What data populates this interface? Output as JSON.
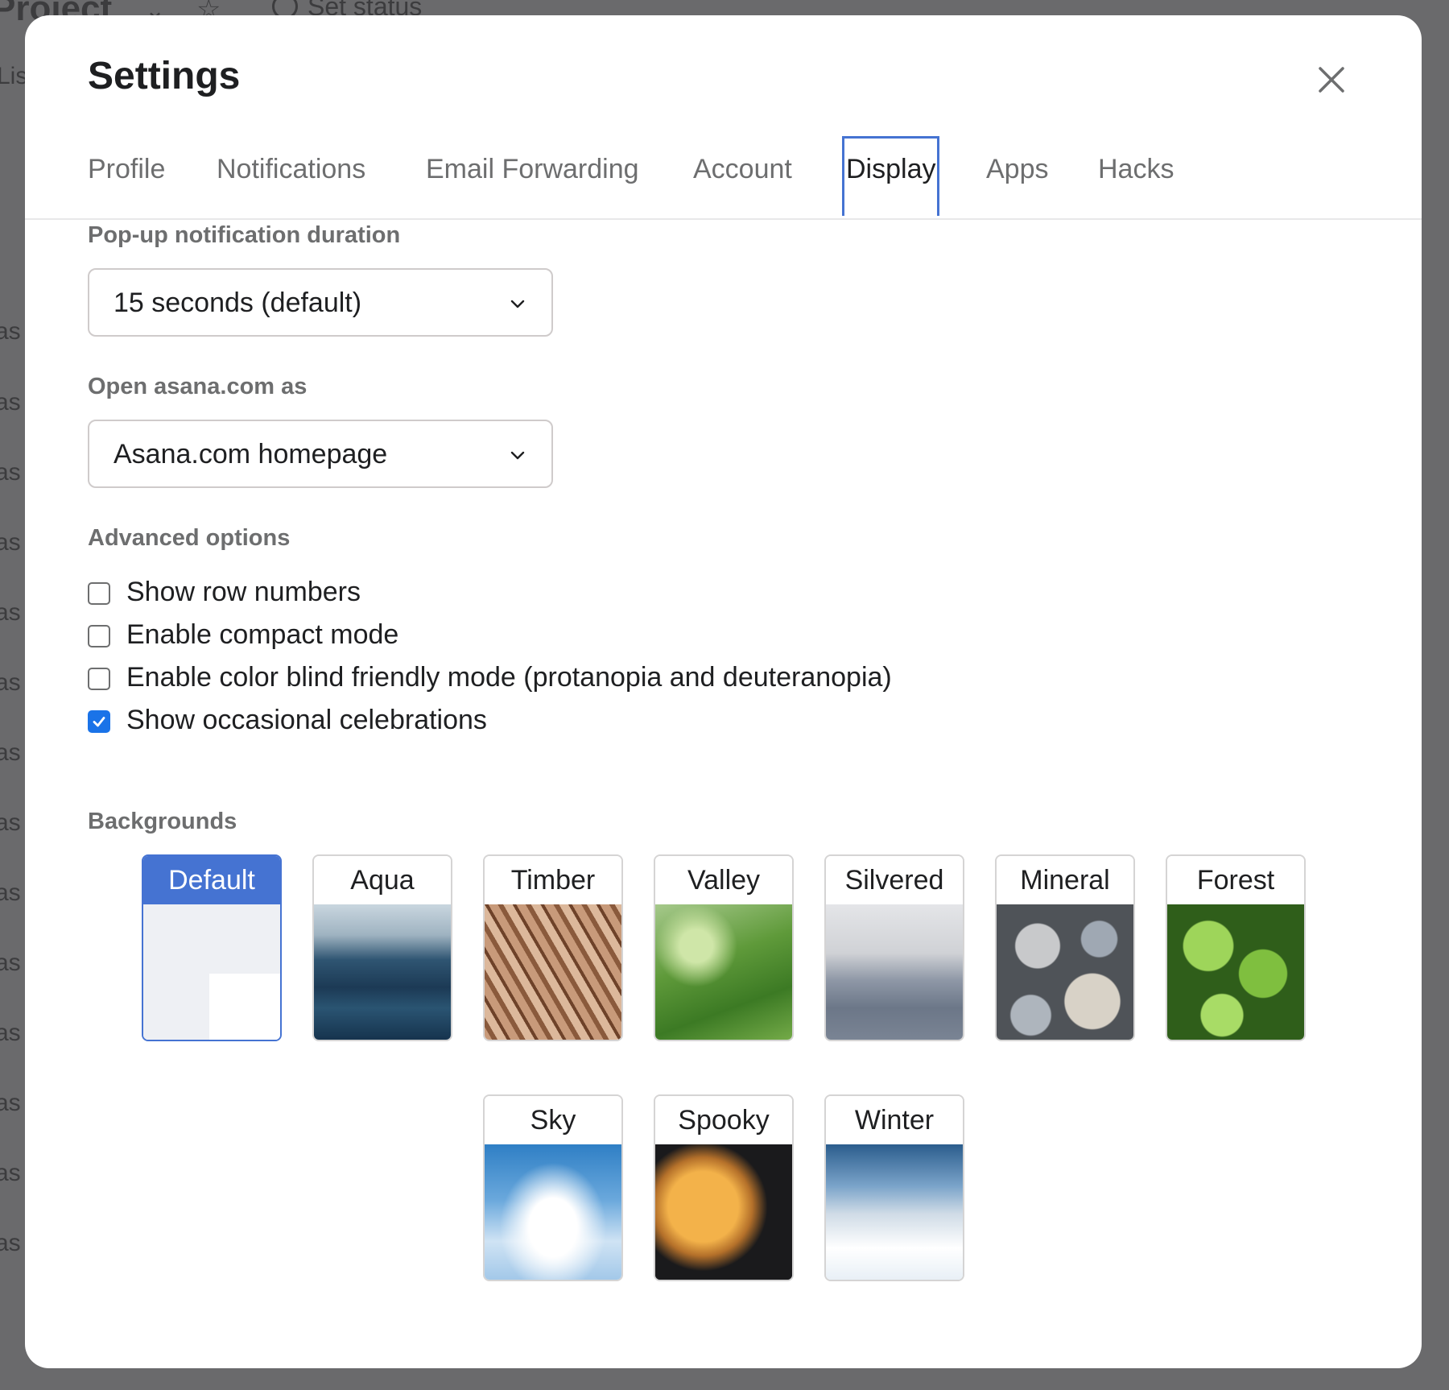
{
  "background_app": {
    "title": "Project",
    "status": "Set status",
    "tab": "List",
    "row_text": "as"
  },
  "modal": {
    "title": "Settings",
    "close_icon": "close-icon"
  },
  "tabs": [
    {
      "label": "Profile",
      "active": false
    },
    {
      "label": "Notifications",
      "active": false
    },
    {
      "label": "Email Forwarding",
      "active": false
    },
    {
      "label": "Account",
      "active": false
    },
    {
      "label": "Display",
      "active": true
    },
    {
      "label": "Apps",
      "active": false
    },
    {
      "label": "Hacks",
      "active": false
    }
  ],
  "popup_duration": {
    "label": "Pop-up notification duration",
    "value": "15 seconds (default)"
  },
  "open_as": {
    "label": "Open asana.com as",
    "value": "Asana.com homepage"
  },
  "advanced": {
    "label": "Advanced options",
    "options": [
      {
        "label": "Show row numbers",
        "checked": false
      },
      {
        "label": "Enable compact mode",
        "checked": false
      },
      {
        "label": "Enable color blind friendly mode (protanopia and deuteranopia)",
        "checked": false
      },
      {
        "label": "Show occasional celebrations",
        "checked": true
      }
    ]
  },
  "backgrounds": {
    "label": "Backgrounds",
    "items": [
      {
        "label": "Default",
        "selected": true
      },
      {
        "label": "Aqua",
        "selected": false
      },
      {
        "label": "Timber",
        "selected": false
      },
      {
        "label": "Valley",
        "selected": false
      },
      {
        "label": "Silvered",
        "selected": false
      },
      {
        "label": "Mineral",
        "selected": false
      },
      {
        "label": "Forest",
        "selected": false
      },
      {
        "label": "Sky",
        "selected": false
      },
      {
        "label": "Spooky",
        "selected": false
      },
      {
        "label": "Winter",
        "selected": false
      }
    ]
  },
  "colors": {
    "accent": "#4573d2",
    "checkbox_checked": "#1a73e8"
  }
}
